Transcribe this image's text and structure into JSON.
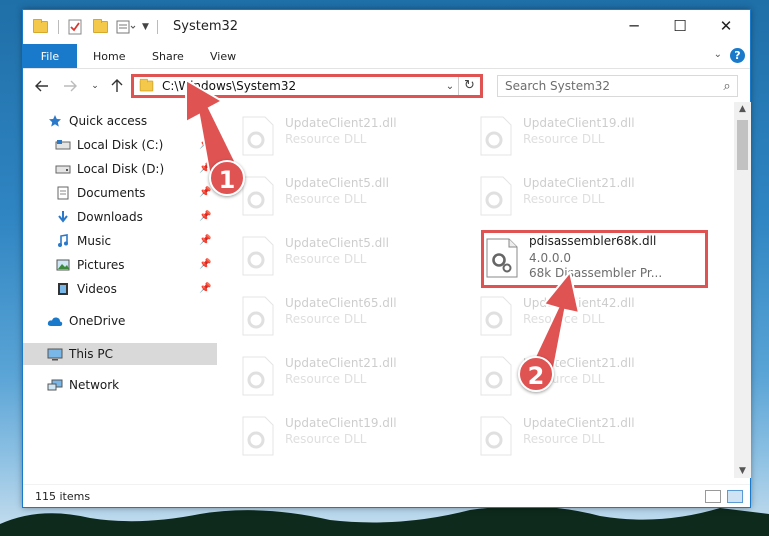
{
  "window": {
    "title": "System32",
    "controls": {
      "minimize": "─",
      "maximize": "☐",
      "close": "✕"
    }
  },
  "ribbon": {
    "tabs": [
      "File",
      "Home",
      "Share",
      "View"
    ],
    "help": "?"
  },
  "nav": {
    "address": "C:\\Windows\\System32",
    "search_placeholder": "Search System32"
  },
  "sidebar": {
    "items": [
      {
        "label": "Quick access",
        "icon": "star-icon",
        "pinned": false
      },
      {
        "label": "Local Disk (C:)",
        "icon": "drive-icon",
        "pinned": true
      },
      {
        "label": "Local Disk (D:)",
        "icon": "drive-icon",
        "pinned": true
      },
      {
        "label": "Documents",
        "icon": "documents-icon",
        "pinned": true
      },
      {
        "label": "Downloads",
        "icon": "download-icon",
        "pinned": true
      },
      {
        "label": "Music",
        "icon": "music-icon",
        "pinned": true
      },
      {
        "label": "Pictures",
        "icon": "pictures-icon",
        "pinned": true
      },
      {
        "label": "Videos",
        "icon": "videos-icon",
        "pinned": true
      },
      {
        "label": "OneDrive",
        "icon": "cloud-icon",
        "pinned": false
      },
      {
        "label": "This PC",
        "icon": "computer-icon",
        "pinned": false,
        "selected": true
      },
      {
        "label": "Network",
        "icon": "network-icon",
        "pinned": false
      }
    ]
  },
  "files": {
    "left": [
      {
        "name": "UpdateClient21.dll",
        "desc": "Resource DLL"
      },
      {
        "name": "UpdateClient5.dll",
        "desc": "Resource DLL"
      },
      {
        "name": "UpdateClient5.dll",
        "desc": "Resource DLL"
      },
      {
        "name": "UpdateClient65.dll",
        "desc": "Resource DLL"
      },
      {
        "name": "UpdateClient21.dll",
        "desc": "Resource DLL"
      },
      {
        "name": "UpdateClient19.dll",
        "desc": "Resource DLL"
      }
    ],
    "right": [
      {
        "name": "UpdateClient19.dll",
        "desc": "Resource DLL"
      },
      {
        "name": "UpdateClient21.dll",
        "desc": "Resource DLL"
      },
      {
        "name": "pdisassembler68k.dll",
        "version": "4.0.0.0",
        "desc": "68k Disassembler Pr..."
      },
      {
        "name": "UpdateClient42.dll",
        "desc": "Resource DLL"
      },
      {
        "name": "UpdateClient21.dll",
        "desc": "Resource DLL"
      },
      {
        "name": "UpdateClient21.dll",
        "desc": "Resource DLL"
      }
    ]
  },
  "status": {
    "items": "115 items"
  },
  "markers": [
    "1",
    "2"
  ],
  "colors": {
    "accent": "#1979ca",
    "highlight": "#e05353"
  }
}
